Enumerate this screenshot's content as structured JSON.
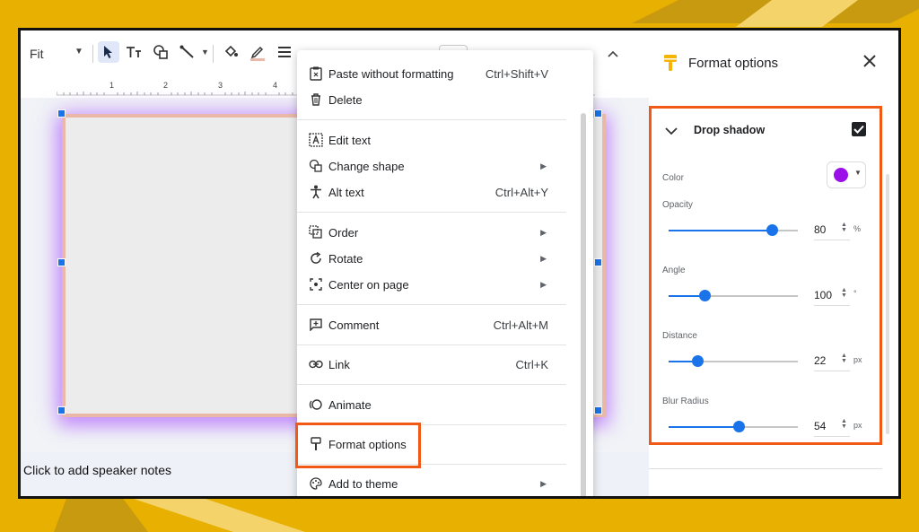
{
  "toolbar": {
    "zoom_label": "Fit",
    "icons": [
      "select-icon",
      "text-box-icon",
      "shapes-icon",
      "line-icon",
      "fill-color-icon",
      "border-color-icon",
      "border-weight-icon"
    ]
  },
  "ruler": {
    "ticks": [
      "1",
      "2",
      "3",
      "4"
    ]
  },
  "speaker_notes": {
    "placeholder": "Click to add speaker notes"
  },
  "context_menu": {
    "items": [
      {
        "label": "Paste without formatting",
        "shortcut": "Ctrl+Shift+V",
        "icon": "paste-plain-icon"
      },
      {
        "label": "Delete",
        "shortcut": "",
        "icon": "trash-icon"
      },
      {
        "label": "Edit text",
        "shortcut": "",
        "icon": "edit-text-icon"
      },
      {
        "label": "Change shape",
        "shortcut": "",
        "icon": "change-shape-icon",
        "submenu": true
      },
      {
        "label": "Alt text",
        "shortcut": "Ctrl+Alt+Y",
        "icon": "accessibility-icon"
      },
      {
        "label": "Order",
        "shortcut": "",
        "icon": "order-icon",
        "submenu": true
      },
      {
        "label": "Rotate",
        "shortcut": "",
        "icon": "rotate-icon",
        "submenu": true
      },
      {
        "label": "Center on page",
        "shortcut": "",
        "icon": "center-icon",
        "submenu": true
      },
      {
        "label": "Comment",
        "shortcut": "Ctrl+Alt+M",
        "icon": "comment-icon"
      },
      {
        "label": "Link",
        "shortcut": "Ctrl+K",
        "icon": "link-icon"
      },
      {
        "label": "Animate",
        "shortcut": "",
        "icon": "animate-icon"
      },
      {
        "label": "Format options",
        "shortcut": "",
        "icon": "format-paint-icon",
        "highlighted": true
      },
      {
        "label": "Add to theme",
        "shortcut": "",
        "icon": "palette-icon",
        "submenu": true
      }
    ]
  },
  "panel": {
    "title": "Format options",
    "section": "Drop shadow",
    "enabled": true,
    "color_label": "Color",
    "shadow_color": "#9b10e8",
    "opacity": {
      "label": "Opacity",
      "value": "80",
      "unit": "%",
      "fraction": 0.8
    },
    "angle": {
      "label": "Angle",
      "value": "100",
      "unit": "°",
      "fraction": 0.28
    },
    "distance": {
      "label": "Distance",
      "value": "22",
      "unit": "px",
      "fraction": 0.22
    },
    "blur": {
      "label": "Blur Radius",
      "value": "54",
      "unit": "px",
      "fraction": 0.54
    }
  },
  "colors": {
    "highlight": "#f15a16",
    "accent": "#1a73e8"
  }
}
